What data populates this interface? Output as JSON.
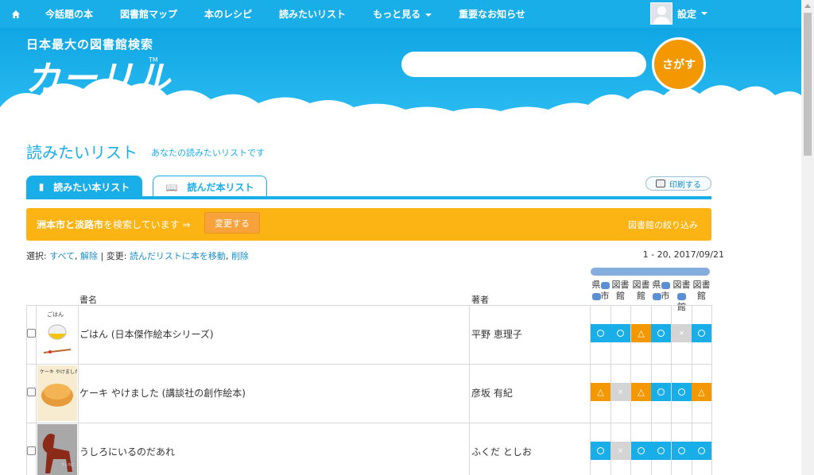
{
  "nav": {
    "items": [
      {
        "label": "今話題の本",
        "caret": false
      },
      {
        "label": "図書館マップ",
        "caret": false
      },
      {
        "label": "本のレシピ",
        "caret": false
      },
      {
        "label": "読みたいリスト",
        "caret": false
      },
      {
        "label": "もっと見る",
        "caret": true
      },
      {
        "label": "重要なお知らせ",
        "caret": false
      }
    ],
    "settings_label": "設定"
  },
  "header": {
    "logo_sub": "日本最大の図書館検索",
    "logo_main": "カーリル",
    "logo_tm": "TM",
    "search_placeholder": "",
    "search_button": "さがす"
  },
  "page": {
    "title": "読みたいリスト",
    "subtitle": "あなたの読みたいリストです"
  },
  "tabs": {
    "want": "読みたい本リスト",
    "read": "読んだ本リスト",
    "print": "印刷する"
  },
  "banner": {
    "places": "洲本市と淡路市",
    "text": "を検索しています ⇒",
    "change_button": "変更する",
    "filter_link": "図書館の絞り込み"
  },
  "selection": {
    "prefix": "選択:",
    "all": "すべて",
    "clear": "解除",
    "separator": "| 変更:",
    "move": "読んだリストに本を移動",
    "delete": "削除",
    "range": "1 - 20, 2017/09/21"
  },
  "table": {
    "col_title": "書名",
    "col_author": "著者",
    "libraries": [
      {
        "line1": "県",
        "line2": "市",
        "blur1": true,
        "blur2": true
      },
      {
        "line1": "図書",
        "line2": "館",
        "blur1": false,
        "blur2": false
      },
      {
        "line1": "図書",
        "line2": "館",
        "blur1": false,
        "blur2": false
      },
      {
        "line1": "県",
        "line2": "市",
        "blur1": true,
        "blur2": true
      },
      {
        "line1": "図書",
        "line2": "館",
        "blur1": true,
        "blur2": false
      },
      {
        "line1": "図書",
        "line2": "館",
        "blur1": false,
        "blur2": false
      }
    ],
    "rows": [
      {
        "title": "ごはん (日本傑作絵本シリーズ)",
        "author": "平野 恵理子",
        "cover_text": "ごはん",
        "status": [
          "ok",
          "ok",
          "tri",
          "ok",
          "none",
          "ok"
        ]
      },
      {
        "title": "ケーキ やけました (講談社の創作絵本)",
        "author": "彦坂 有紀",
        "cover_text": "ケーキ やけました",
        "status": [
          "tri",
          "none",
          "tri",
          "ok",
          "ok",
          "tri"
        ]
      },
      {
        "title": "うしろにいるのだあれ",
        "author": "ふくだ としお",
        "cover_text": "うしろにいるのだあれ",
        "status": [
          "ok",
          "none",
          "ok",
          "ok",
          "ok",
          "ok"
        ]
      }
    ],
    "status_symbols": {
      "ok": "",
      "tri": "△",
      "none": "×"
    }
  }
}
